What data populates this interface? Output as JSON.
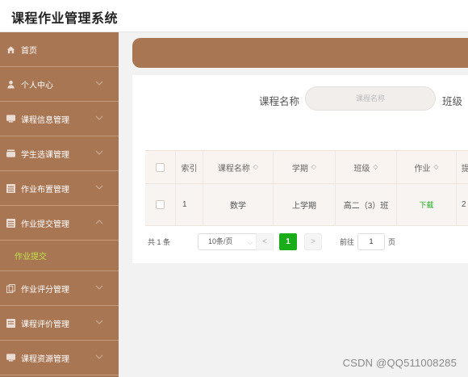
{
  "app": {
    "title": "课程作业管理系统"
  },
  "sidebar": {
    "items": [
      {
        "label": "首页",
        "icon": "home-icon",
        "has_children": false
      },
      {
        "label": "个人中心",
        "icon": "user-icon",
        "has_children": true
      },
      {
        "label": "课程信息管理",
        "icon": "list-icon",
        "has_children": true
      },
      {
        "label": "学生选课管理",
        "icon": "list-icon",
        "has_children": true
      },
      {
        "label": "作业布置管理",
        "icon": "grid-icon",
        "has_children": true
      },
      {
        "label": "作业提交管理",
        "icon": "grid-icon",
        "has_children": true,
        "expanded": true,
        "children": [
          {
            "label": "作业提交",
            "active": true
          }
        ]
      },
      {
        "label": "作业评分管理",
        "icon": "copy-icon",
        "has_children": true
      },
      {
        "label": "课程评价管理",
        "icon": "grid-icon",
        "has_children": true
      },
      {
        "label": "课程资源管理",
        "icon": "list-icon",
        "has_children": true
      }
    ]
  },
  "search": {
    "course_name_label": "课程名称",
    "course_name_placeholder": "课程名称",
    "class_label": "班级"
  },
  "table": {
    "columns": [
      "",
      "索引",
      "课程名称",
      "学期",
      "班级",
      "作业",
      "提"
    ],
    "rows": [
      {
        "index": "1",
        "course_name": "数学",
        "semester": "上学期",
        "class": "高二（3）班",
        "homework": "下载",
        "extra": "2"
      }
    ]
  },
  "pagination": {
    "total_text": "共 1 条",
    "page_size": "10条/页",
    "prev": "<",
    "current_page": "1",
    "next": ">",
    "goto_label": "前往",
    "goto_value": "1",
    "goto_unit": "页"
  },
  "watermark": "CSDN @QQ511008285",
  "colors": {
    "accent": "#a97654",
    "link": "#1aad19",
    "submenu_active": "#bfe04a"
  }
}
